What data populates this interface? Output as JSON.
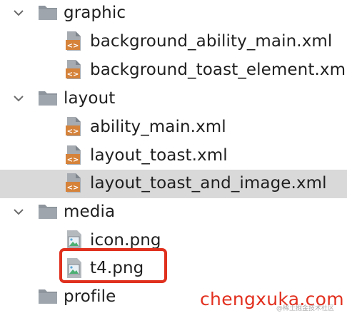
{
  "tree": {
    "graphic_folder": {
      "label": "graphic",
      "icon": "folder-icon",
      "expanded": true
    },
    "background_ability_main": {
      "label": "background_ability_main.xml",
      "icon": "xml-file-icon"
    },
    "background_toast_element": {
      "label": "background_toast_element.xml",
      "icon": "xml-file-icon"
    },
    "layout_folder": {
      "label": "layout",
      "icon": "folder-icon",
      "expanded": true
    },
    "ability_main": {
      "label": "ability_main.xml",
      "icon": "xml-file-icon"
    },
    "layout_toast": {
      "label": "layout_toast.xml",
      "icon": "xml-file-icon"
    },
    "layout_toast_and_image": {
      "label": "layout_toast_and_image.xml",
      "icon": "xml-file-icon",
      "selected": true
    },
    "media_folder": {
      "label": "media",
      "icon": "folder-icon",
      "expanded": true
    },
    "icon_png": {
      "label": "icon.png",
      "icon": "image-file-icon"
    },
    "t4_png": {
      "label": "t4.png",
      "icon": "image-file-icon",
      "highlighted": true
    },
    "profile_folder": {
      "label": "profile",
      "icon": "folder-icon"
    }
  },
  "watermark": {
    "text": "chengxuka.com",
    "small_text": "@稀土掘金技术社区"
  },
  "colors": {
    "selected_row": "#d9d9d9",
    "folder": "#8e959d",
    "xml_icon": "#d5823a",
    "highlight_border": "#e0301e",
    "watermark": "#e2301f"
  }
}
